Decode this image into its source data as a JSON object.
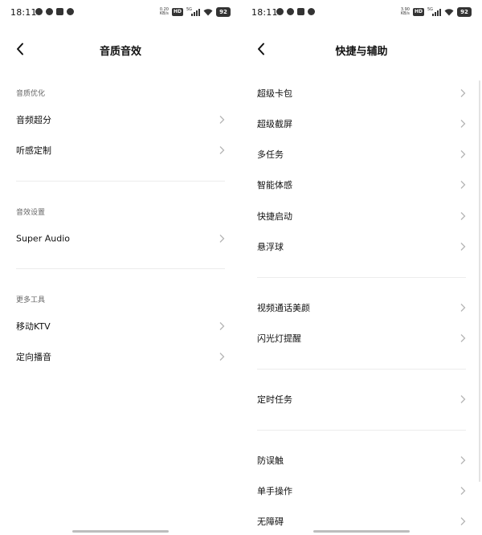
{
  "left": {
    "status": {
      "time": "18:11",
      "net_speed": "0.20",
      "net_unit": "KB/s",
      "hd": "HD",
      "network": "5G",
      "battery": "92"
    },
    "title": "音质音效",
    "sections": [
      {
        "label": "音质优化",
        "items": [
          "音频超分",
          "听感定制"
        ]
      },
      {
        "label": "音效设置",
        "items": [
          "Super Audio"
        ]
      },
      {
        "label": "更多工具",
        "items": [
          "移动KTV",
          "定向播音"
        ]
      }
    ]
  },
  "right": {
    "status": {
      "time": "18:11",
      "net_speed": "3.90",
      "net_unit": "KB/s",
      "hd": "HD",
      "network": "5G",
      "battery": "92"
    },
    "title": "快捷与辅助",
    "groups": [
      [
        "超级卡包",
        "超级截屏",
        "多任务",
        "智能体感",
        "快捷启动",
        "悬浮球"
      ],
      [
        "视频通话美颜",
        "闪光灯提醒"
      ],
      [
        "定时任务"
      ],
      [
        "防误触",
        "单手操作",
        "无障碍"
      ]
    ]
  }
}
